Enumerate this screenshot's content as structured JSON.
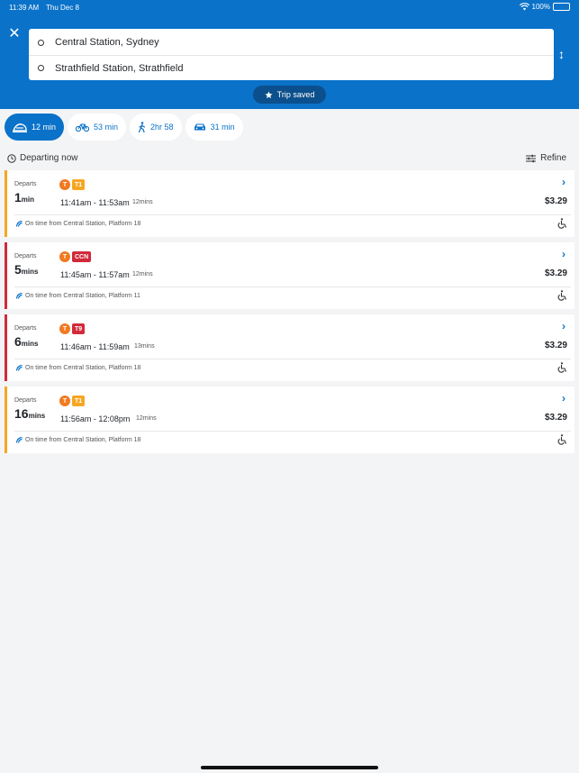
{
  "status_bar": {
    "time": "11:39 AM",
    "date": "Thu Dec 8",
    "battery": "100%"
  },
  "search": {
    "origin": "Central Station, Sydney",
    "destination": "Strathfield Station, Strathfield"
  },
  "trip_saved_label": "Trip saved",
  "modes": [
    {
      "label": "12 min",
      "icon": "train-icon",
      "active": true
    },
    {
      "label": "53 min",
      "icon": "bicycle-icon",
      "active": false
    },
    {
      "label": "2hr 58",
      "icon": "walk-icon",
      "active": false
    },
    {
      "label": "31 min",
      "icon": "car-icon",
      "active": false
    }
  ],
  "departing_now": "Departing now",
  "refine": "Refine",
  "trips": [
    {
      "departs_label": "Departs",
      "departs_value": "1",
      "departs_unit": "min",
      "mode_badge": "T",
      "line": "T1",
      "line_color": "#f6a623",
      "times": "11:41am - 11:53am",
      "duration": "12mins",
      "price": "$3.29",
      "status": "On time from Central Station, Platform 18",
      "accent": "#f6a623"
    },
    {
      "departs_label": "Departs",
      "departs_value": "5",
      "departs_unit": "mins",
      "mode_badge": "T",
      "line": "CCN",
      "line_color": "#d12a3a",
      "times": "11:45am - 11:57am",
      "duration": "12mins",
      "price": "$3.29",
      "status": "On time from Central Station, Platform 11",
      "accent": "#d12a3a"
    },
    {
      "departs_label": "Departs",
      "departs_value": "6",
      "departs_unit": "mins",
      "mode_badge": "T",
      "line": "T9",
      "line_color": "#d12a3a",
      "times": "11:46am - 11:59am",
      "duration": "13mins",
      "price": "$3.29",
      "status": "On time from Central Station, Platform 18",
      "accent": "#d12a3a"
    },
    {
      "departs_label": "Departs",
      "departs_value": "16",
      "departs_unit": "mins",
      "mode_badge": "T",
      "line": "T1",
      "line_color": "#f6a623",
      "times": "11:56am - 12:08pm",
      "duration": "12mins",
      "price": "$3.29",
      "status": "On time from Central Station, Platform 18",
      "accent": "#f6a623"
    }
  ],
  "colors": {
    "header": "#0a72c9",
    "saved_pill": "#0b4f8c",
    "train_badge": "#f17a21"
  }
}
